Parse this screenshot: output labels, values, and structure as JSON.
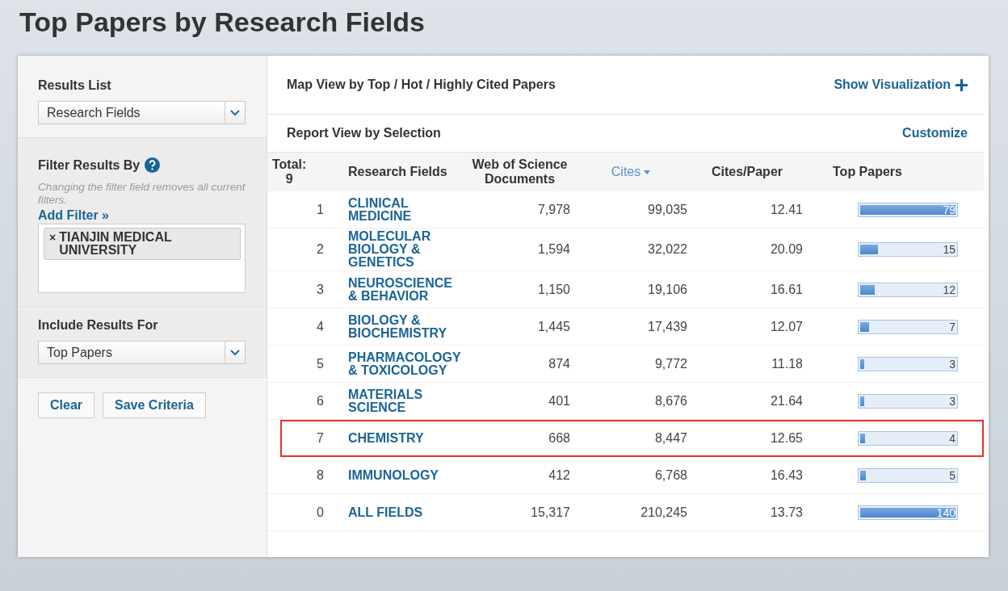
{
  "page_title": "Top Papers by Research Fields",
  "sidebar": {
    "results_list": {
      "label": "Results List",
      "value": "Research Fields"
    },
    "filter": {
      "label": "Filter Results By",
      "hint": "Changing the filter field removes all current filters.",
      "add_link": "Add Filter »",
      "chips": [
        {
          "remove": "×",
          "text": "TIANJIN MEDICAL UNIVERSITY"
        }
      ]
    },
    "include": {
      "label": "Include Results For",
      "value": "Top Papers"
    },
    "buttons": [
      "Clear",
      "Save Criteria"
    ]
  },
  "main": {
    "map_view": "Map View by Top / Hot / Highly Cited Papers",
    "show_visualization": "Show Visualization",
    "report_view": "Report View by Selection",
    "customize": "Customize",
    "table": {
      "columns": [
        {
          "label": "Total:\n9",
          "sorted": false
        },
        {
          "label": "Research Fields",
          "sorted": false
        },
        {
          "label": "Web of Science Documents",
          "sorted": false
        },
        {
          "label": "Cites",
          "sorted": true
        },
        {
          "label": "Cites/Paper",
          "sorted": false
        },
        {
          "label": "Top Papers",
          "sorted": false
        }
      ],
      "rows": [
        {
          "rank": "1",
          "field": "CLINICAL MEDICINE",
          "documents": "7,978",
          "cites": "99,035",
          "cites_per_paper": "12.41",
          "top_papers": "79",
          "level": 1.0,
          "highlighted": false
        },
        {
          "rank": "2",
          "field": "MOLECULAR BIOLOGY & GENETICS",
          "documents": "1,594",
          "cites": "32,022",
          "cites_per_paper": "20.09",
          "top_papers": "15",
          "level": 0.19,
          "highlighted": false
        },
        {
          "rank": "3",
          "field": "NEUROSCIENCE & BEHAVIOR",
          "documents": "1,150",
          "cites": "19,106",
          "cites_per_paper": "16.61",
          "top_papers": "12",
          "level": 0.15,
          "highlighted": false
        },
        {
          "rank": "4",
          "field": "BIOLOGY & BIOCHEMISTRY",
          "documents": "1,445",
          "cites": "17,439",
          "cites_per_paper": "12.07",
          "top_papers": "7",
          "level": 0.09,
          "highlighted": false
        },
        {
          "rank": "5",
          "field": "PHARMACOLOGY & TOXICOLOGY",
          "documents": "874",
          "cites": "9,772",
          "cites_per_paper": "11.18",
          "top_papers": "3",
          "level": 0.04,
          "highlighted": false
        },
        {
          "rank": "6",
          "field": "MATERIALS SCIENCE",
          "documents": "401",
          "cites": "8,676",
          "cites_per_paper": "21.64",
          "top_papers": "3",
          "level": 0.04,
          "highlighted": false
        },
        {
          "rank": "7",
          "field": "CHEMISTRY",
          "documents": "668",
          "cites": "8,447",
          "cites_per_paper": "12.65",
          "top_papers": "4",
          "level": 0.05,
          "highlighted": true
        },
        {
          "rank": "8",
          "field": "IMMUNOLOGY",
          "documents": "412",
          "cites": "6,768",
          "cites_per_paper": "16.43",
          "top_papers": "5",
          "level": 0.06,
          "highlighted": false
        },
        {
          "rank": "0",
          "field": "ALL FIELDS",
          "documents": "15,317",
          "cites": "210,245",
          "cites_per_paper": "13.73",
          "top_papers": "140",
          "level": 1.0,
          "highlighted": false
        }
      ]
    }
  }
}
